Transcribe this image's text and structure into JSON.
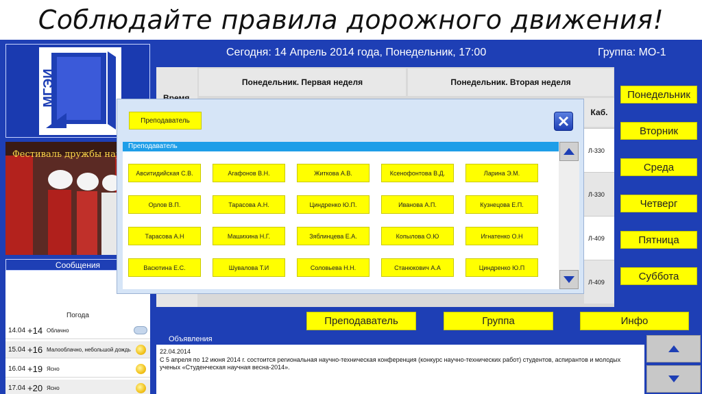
{
  "banner": {
    "text": "Соблюдайте правила дорожного движения!"
  },
  "header": {
    "today": "Сегодня: 14 Апрель 2014 года, Понедельник, 17:00",
    "group": "Группа: МО-1"
  },
  "logo": {
    "text": "МГЭИ"
  },
  "photo": {
    "caption": "Фестиваль дружбы народ"
  },
  "messages": {
    "title": "Сообщения"
  },
  "weather": {
    "title": "Погода",
    "rows": [
      {
        "date": "14.04",
        "temp": "+14",
        "desc": "Облачно",
        "icon": "cloud-icon"
      },
      {
        "date": "15.04",
        "temp": "+16",
        "desc": "Малооблачно, небольшой дождь",
        "icon": "sun-cloud-icon"
      },
      {
        "date": "16.04",
        "temp": "+19",
        "desc": "Ясно",
        "icon": "sun-icon"
      },
      {
        "date": "17.04",
        "temp": "+20",
        "desc": "Ясно",
        "icon": "sun-icon"
      }
    ]
  },
  "schedule": {
    "time_header": "Время",
    "week1_header": "Понедельник. Первая неделя",
    "week2_header": "Понедельник. Вторая неделя",
    "room_header": "Каб.",
    "rooms": [
      "Л-330",
      "Л-330",
      "Л-409",
      "Л-409"
    ]
  },
  "days": [
    "Понедельник",
    "Вторник",
    "Среда",
    "Четверг",
    "Пятница",
    "Суббота"
  ],
  "bottom_buttons": {
    "teacher": "Преподаватель",
    "group": "Группа",
    "info": "Инфо"
  },
  "announcements": {
    "title": "Объявления",
    "date": "22.04.2014",
    "text": "С 5 апреля по 12 июня 2014 г. состоится региональная научно-техническая конференция (конкурс научно-технических работ) студентов, аспирантов и молодых ученых «Студенческая научная весна-2014»."
  },
  "modal": {
    "top_button": "Преподаватель",
    "list_header": "Преподаватель",
    "teachers": [
      "Авситидийская С.В.",
      "Агафонов В.Н.",
      "Житкова А.В.",
      "Ксенофонтова В.Д.",
      "Ларина Э.М.",
      "Орлов В.П.",
      "Тарасова А.Н.",
      "Циндренко Ю.П.",
      "Иванова А.П.",
      "Кузнецова Е.П.",
      "Тарасова А.Н",
      "Машихина Н.Г.",
      "Зяблинцева Е.А.",
      "Копылова О.Ю",
      "Игнатенко О.Н",
      "Васютина Е.С.",
      "Шувалова Т.И",
      "Соловьева Н.Н.",
      "Станюкович А.А",
      "Циндренко Ю.П"
    ]
  },
  "colors": {
    "app_bg": "#1e3fb5",
    "button_yellow": "#ffff00",
    "modal_bg": "#d6e5f7",
    "list_header": "#1e9ee8"
  }
}
